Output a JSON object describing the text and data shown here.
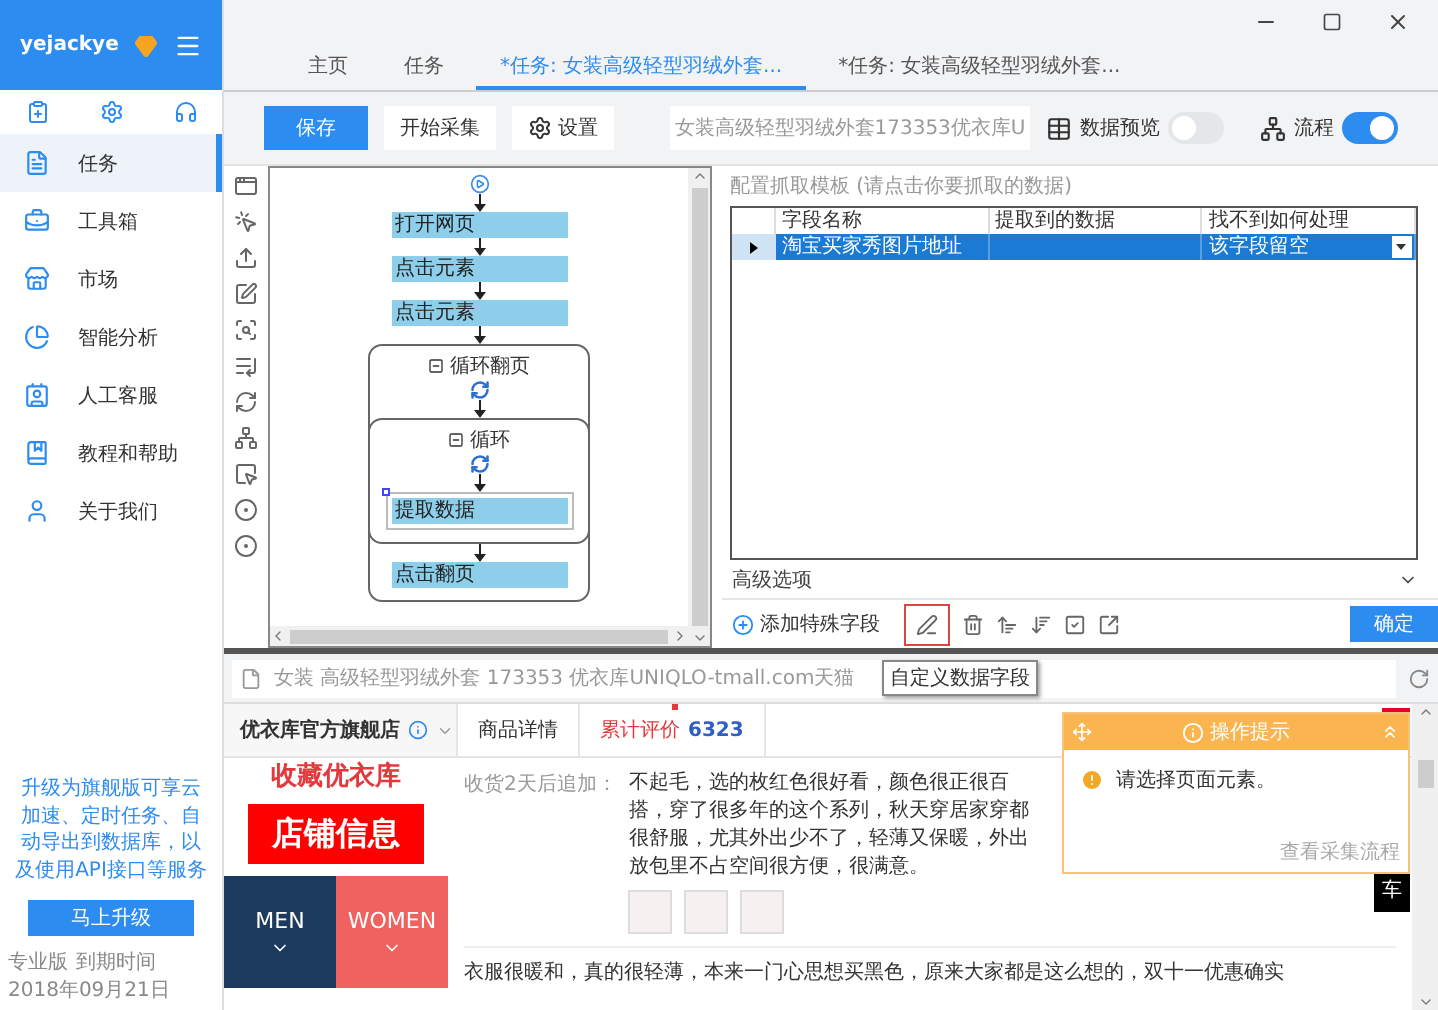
{
  "user": {
    "name": "yejackye"
  },
  "nav": [
    {
      "label": "任务",
      "selected": true
    },
    {
      "label": "工具箱",
      "selected": false
    },
    {
      "label": "市场",
      "selected": false
    },
    {
      "label": "智能分析",
      "selected": false
    },
    {
      "label": "人工客服",
      "selected": false
    },
    {
      "label": "教程和帮助",
      "selected": false
    },
    {
      "label": "关于我们",
      "selected": false
    }
  ],
  "upgrade": {
    "text": "升级为旗舰版可享云加速、定时任务、自动导出到数据库，以及使用API接口等服务",
    "button": "马上升级"
  },
  "license": {
    "edition": "专业版",
    "expiry_label": "到期时间",
    "expiry_date": "2018年09月21日"
  },
  "tabs": [
    {
      "label": "主页",
      "selected": false
    },
    {
      "label": "任务",
      "selected": false
    },
    {
      "label": "*任务: 女装高级轻型羽绒外套...",
      "selected": true
    },
    {
      "label": "*任务: 女装高级轻型羽绒外套...",
      "selected": false
    }
  ],
  "toolbar": {
    "save": "保存",
    "start": "开始采集",
    "settings": "设置",
    "url": "女装高级轻型羽绒外套173353优衣库U",
    "preview": {
      "label": "数据预览",
      "on": false
    },
    "flow": {
      "label": "流程",
      "on": true
    }
  },
  "flow": {
    "nodes": [
      {
        "kind": "action",
        "label": "打开网页",
        "selected": false
      },
      {
        "kind": "action",
        "label": "点击元素",
        "selected": false
      },
      {
        "kind": "action",
        "label": "点击元素",
        "selected": false
      },
      {
        "kind": "loop",
        "label": "循环翻页",
        "expanded": true,
        "children": [
          {
            "kind": "loop",
            "label": "循环",
            "expanded": true,
            "children": [
              {
                "kind": "action",
                "label": "提取数据",
                "selected": true
              }
            ]
          },
          {
            "kind": "action",
            "label": "点击翻页",
            "selected": false
          }
        ]
      }
    ]
  },
  "extract": {
    "caption": "配置抓取模板 (请点击你要抓取的数据)",
    "columns": [
      "字段名称",
      "提取到的数据",
      "找不到如何处理"
    ],
    "rows": [
      {
        "field": "淘宝买家秀图片地址",
        "fallback": "该字段留空",
        "selected": true
      }
    ],
    "advanced": "高级选项",
    "add_field": "添加特殊字段",
    "confirm": "确定",
    "tooltip": "自定义数据字段"
  },
  "browser": {
    "title": "女装 高级轻型羽绒外套 173353 优衣库UNIQLO-tmall.com天猫",
    "store": "优衣库官方旗舰店",
    "tabs": [
      {
        "label": "商品详情",
        "selected": false
      },
      {
        "label": "累计评价",
        "count": "6323",
        "selected": true
      }
    ],
    "favorite": "收藏优衣库",
    "shop_info": "店铺信息",
    "categories": [
      {
        "label": "MEN",
        "color": "#1d3a5f"
      },
      {
        "label": "WOMEN",
        "color": "#f0625f"
      }
    ],
    "reviews": [
      {
        "tag": "收货2天后追加：",
        "text": "不起毛，选的枚红色很好看，颜色很正很百搭，穿了很多年的这个系列，秋天穿居家穿都很舒服，尤其外出少不了，轻薄又保暖，外出放包里不占空间很方便，很满意。",
        "has_photos": true
      },
      {
        "text": "衣服很暖和，真的很轻薄，本来一门心思想买黑色，原来大家都是这么想的，双十一优惠确实",
        "has_photos": false
      }
    ],
    "cart_label": "车",
    "popup": {
      "title": "操作提示",
      "message": "请选择页面元素。",
      "link": "查看采集流程"
    }
  }
}
